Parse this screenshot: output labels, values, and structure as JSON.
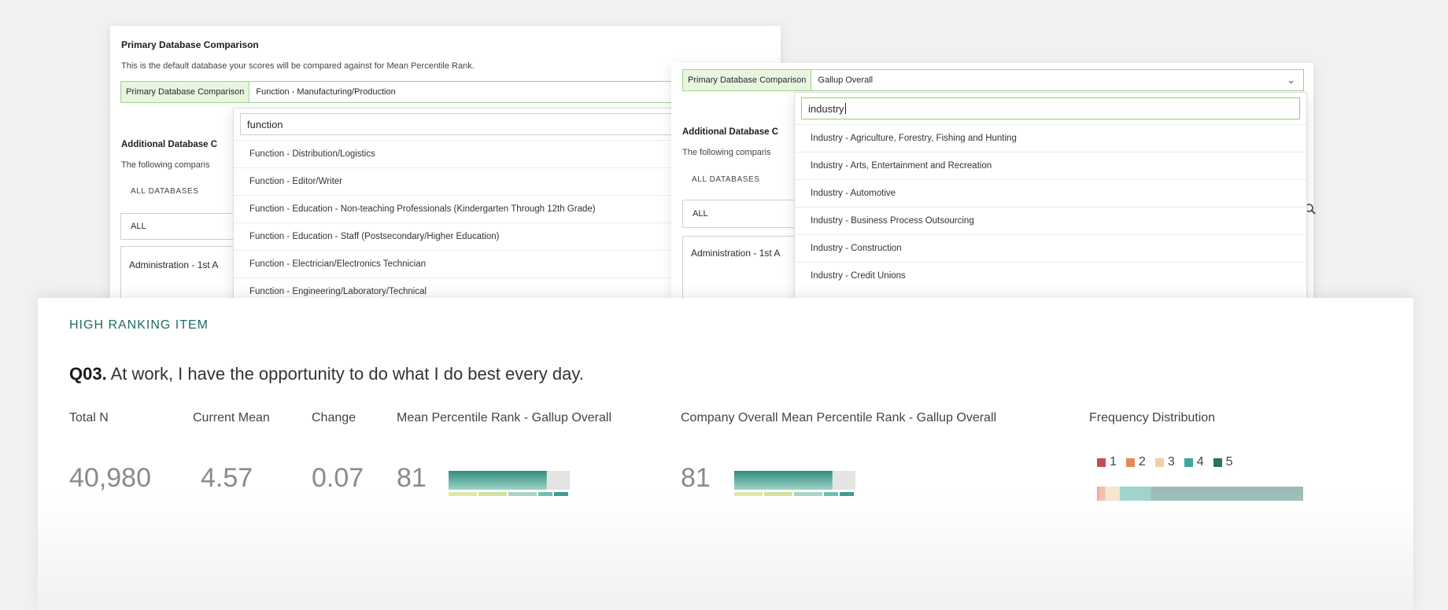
{
  "primary_panel": {
    "title": "Primary Database Comparison",
    "description": "This is the default database your scores will be compared against for Mean Percentile Rank.",
    "select_label": "Primary Database Comparison",
    "select_value": "Function - Manufacturing/Production",
    "additional_title": "Additional Database C",
    "additional_desc": "The following comparis",
    "all_databases_label": "ALL DATABASES",
    "all_box_value": "ALL",
    "admin_box_value": "Administration - 1st A",
    "dropdown": {
      "search_value": "function",
      "items": [
        "Function - Distribution/Logistics",
        "Function - Editor/Writer",
        "Function - Education - Non-teaching Professionals (Kindergarten Through 12th Grade)",
        "Function - Education - Staff (Postsecondary/Higher Education)",
        "Function - Electrician/Electronics Technician",
        "Function - Engineering/Laboratory/Technical"
      ]
    }
  },
  "secondary_panel": {
    "select_label": "Primary Database Comparison",
    "select_value": "Gallup Overall",
    "chevron_icon": "chevron-down-icon",
    "additional_title": "Additional Database C",
    "additional_desc": "The following comparis",
    "all_databases_label": "ALL DATABASES",
    "all_box_value": "ALL",
    "admin_box_value": "Administration - 1st A",
    "search_icon": "search-icon",
    "dropdown": {
      "search_value": "industry",
      "items": [
        "Industry - Agriculture, Forestry, Fishing and Hunting",
        "Industry - Arts, Entertainment and Recreation",
        "Industry - Automotive",
        "Industry - Business Process Outsourcing",
        "Industry - Construction",
        "Industry - Credit Unions"
      ]
    }
  },
  "item_card": {
    "section_label": "HIGH RANKING ITEM",
    "question_code": "Q03.",
    "question_text": " At work, I have the opportunity to do what I do best every day.",
    "headers": {
      "total_n": "Total N",
      "current_mean": "Current Mean",
      "change": "Change",
      "mpr": "Mean Percentile Rank - Gallup Overall",
      "company_mpr": "Company Overall Mean Percentile Rank - Gallup Overall",
      "freq": "Frequency Distribution"
    },
    "values": {
      "total_n": "40,980",
      "current_mean": "4.57",
      "change": "0.07",
      "mpr": "81",
      "company_mpr": "81"
    },
    "mpr_bar_fill": 0.81,
    "company_mpr_bar_fill": 0.81,
    "legend": [
      {
        "label": "1",
        "color": "#c0504d"
      },
      {
        "label": "2",
        "color": "#e08a5c"
      },
      {
        "label": "3",
        "color": "#f1cfa2"
      },
      {
        "label": "4",
        "color": "#3aa89c"
      },
      {
        "label": "5",
        "color": "#2b6f66"
      }
    ],
    "frequency_distribution": [
      0.01,
      0.03,
      0.07,
      0.15,
      0.74
    ]
  }
}
